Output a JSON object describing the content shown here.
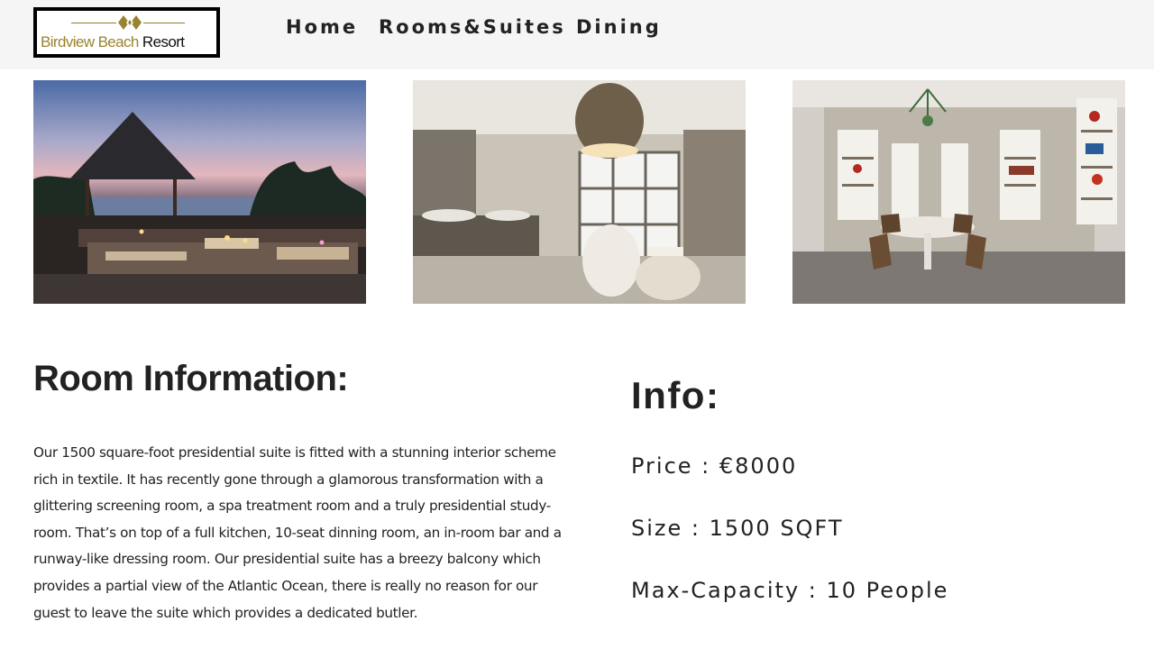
{
  "header": {
    "logo": {
      "name_gold": "Birdview Beach",
      "name_black": "Resort"
    },
    "nav": [
      {
        "label": "Home"
      },
      {
        "label": "Rooms&Suites"
      },
      {
        "label": "Dining"
      }
    ]
  },
  "gallery": [
    {
      "subject": "Outdoor terrace lounge with thatched gazebo at dusk"
    },
    {
      "subject": "Spa bathroom with freestanding bathtub"
    },
    {
      "subject": "Study-dining room with round marble table and bookshelves"
    }
  ],
  "room_info": {
    "title": "Room Information:",
    "description": "Our 1500 square-foot presidential suite is fitted with a stunning interior scheme rich in textile. It has recently gone through a glamorous transformation with a glittering screening room, a spa treatment room and a truly presidential study-room. That’s on top of a full kitchen, 10-seat dinning room, an in-room bar and a runway-like dressing room. Our presidential suite has a breezy balcony which provides a partial view of the Atlantic Ocean, there is really no reason for our guest to leave the suite which provides a dedicated butler."
  },
  "info": {
    "title": "Info:",
    "price": "Price : €8000",
    "size": "Size : 1500 SQFT",
    "capacity": "Max-Capacity : 10 People"
  },
  "colors": {
    "header_bg": "#f5f5f5",
    "logo_gold": "#9a8330",
    "text": "#222222"
  }
}
